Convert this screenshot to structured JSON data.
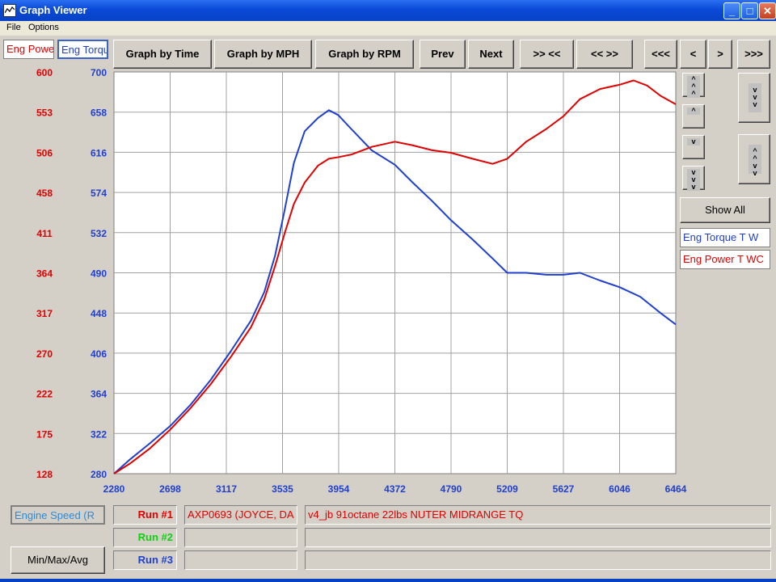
{
  "window": {
    "title": "Graph Viewer",
    "controls": {
      "minimize": "_",
      "maximize": "□",
      "close": "✕"
    }
  },
  "menu": {
    "file": "File",
    "options": "Options"
  },
  "legend_tabs": {
    "power": "Eng Power",
    "torque": "Eng Torque"
  },
  "toolbar": {
    "graph_by_time": "Graph by Time",
    "graph_by_mph": "Graph by MPH",
    "graph_by_rpm": "Graph by RPM",
    "prev": "Prev",
    "next": "Next",
    "zoom_in": ">> <<",
    "zoom_out": "<< >>",
    "scroll_far_left": "<<<",
    "scroll_left": "<",
    "scroll_right": ">",
    "scroll_far_right": ">>>"
  },
  "side_controls": {
    "show_all": "Show All"
  },
  "legend": {
    "torque": "Eng Torque T W",
    "power": "Eng Power T WC"
  },
  "colors": {
    "power": "#e00000",
    "torque": "#1f3fd0",
    "run2": "#10d010",
    "grid": "#a0a0a0"
  },
  "chart_data": {
    "type": "line",
    "x_axis_label": "Engine Speed (R",
    "xlim": [
      2280,
      6464
    ],
    "x_ticks": [
      "2280",
      "2698",
      "3117",
      "3535",
      "3954",
      "4372",
      "4790",
      "5209",
      "5627",
      "6046",
      "6464"
    ],
    "y_left": {
      "name": "Eng Power",
      "ylim": [
        128,
        600
      ],
      "ticks": [
        "600",
        "553",
        "506",
        "458",
        "411",
        "364",
        "317",
        "270",
        "222",
        "175",
        "128"
      ]
    },
    "y_right": {
      "name": "Eng Torque",
      "ylim": [
        280,
        700
      ],
      "ticks": [
        "700",
        "658",
        "616",
        "574",
        "532",
        "490",
        "448",
        "406",
        "364",
        "322",
        "280"
      ]
    },
    "grid": true,
    "series": [
      {
        "name": "Eng Torque T W",
        "axis": "right",
        "x": [
          2280,
          2400,
          2550,
          2700,
          2850,
          3000,
          3150,
          3300,
          3400,
          3480,
          3550,
          3620,
          3700,
          3800,
          3880,
          3950,
          4050,
          4200,
          4372,
          4500,
          4650,
          4790,
          4950,
          5100,
          5209,
          5350,
          5500,
          5627,
          5750,
          5900,
          6046,
          6200,
          6350,
          6464
        ],
        "values": [
          280,
          295,
          312,
          330,
          352,
          378,
          408,
          440,
          470,
          508,
          555,
          605,
          638,
          652,
          660,
          655,
          640,
          618,
          603,
          585,
          565,
          545,
          525,
          505,
          490,
          490,
          488,
          488,
          490,
          482,
          475,
          465,
          448,
          436
        ]
      },
      {
        "name": "Eng Power T WC",
        "axis": "left",
        "x": [
          2280,
          2400,
          2550,
          2700,
          2850,
          3000,
          3150,
          3300,
          3400,
          3480,
          3550,
          3620,
          3700,
          3800,
          3880,
          3954,
          4050,
          4200,
          4372,
          4500,
          4650,
          4790,
          4950,
          5100,
          5209,
          5350,
          5500,
          5627,
          5750,
          5900,
          6046,
          6150,
          6250,
          6350,
          6464
        ],
        "values": [
          128,
          140,
          158,
          180,
          205,
          233,
          265,
          300,
          333,
          372,
          410,
          445,
          470,
          490,
          498,
          500,
          503,
          512,
          518,
          514,
          508,
          505,
          498,
          492,
          498,
          518,
          533,
          548,
          568,
          580,
          585,
          590,
          584,
          572,
          562
        ]
      }
    ]
  },
  "runs": [
    {
      "label": "Run #1",
      "file": "AXP0693 (JOYCE, DA",
      "desc": "v4_jb 91octane 22lbs NUTER MIDRANGE TQ"
    },
    {
      "label": "Run #2",
      "file": "",
      "desc": ""
    },
    {
      "label": "Run #3",
      "file": "",
      "desc": ""
    }
  ],
  "bottom": {
    "minmax": "Min/Max/Avg"
  }
}
